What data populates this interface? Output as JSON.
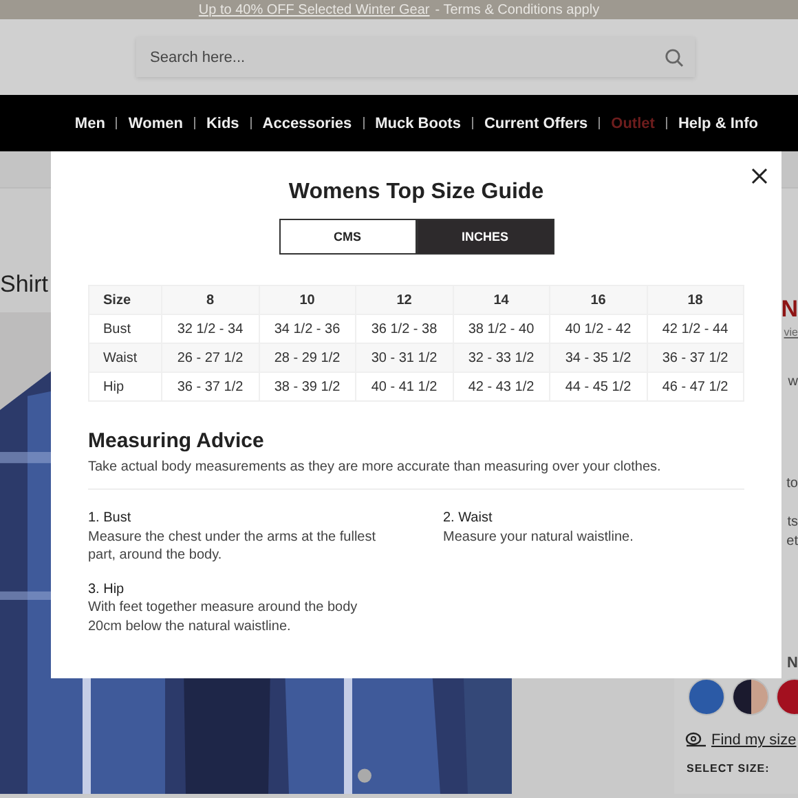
{
  "promo_bar": {
    "link": "Up to 40% OFF Selected Winter Gear",
    "text": "- Terms & Conditions apply"
  },
  "search": {
    "placeholder": "Search here..."
  },
  "nav": [
    {
      "label": "Men",
      "kind": "normal"
    },
    {
      "label": "Women",
      "kind": "normal"
    },
    {
      "label": "Kids",
      "kind": "normal"
    },
    {
      "label": "Accessories",
      "kind": "normal"
    },
    {
      "label": "Muck Boots",
      "kind": "normal"
    },
    {
      "label": "Current Offers",
      "kind": "normal"
    },
    {
      "label": "Outlet",
      "kind": "sale"
    },
    {
      "label": "Help & Info",
      "kind": "normal"
    }
  ],
  "product": {
    "title": "Shirt",
    "side_fragments": [
      {
        "text": "N",
        "kind": "price"
      },
      {
        "text": "vie",
        "kind": "link"
      },
      {
        "text": "w",
        "kind": "text"
      },
      {
        "text": "to",
        "kind": "text"
      },
      {
        "text": "ts",
        "kind": "text"
      },
      {
        "text": "et",
        "kind": "text"
      }
    ],
    "colour_label": "N",
    "swatches": [
      {
        "kind": "solid",
        "color": "#2b5aa6"
      },
      {
        "kind": "split",
        "parts": [
          {
            "color": "#1b1a2e"
          },
          {
            "color": "#c9a08c"
          }
        ]
      },
      {
        "kind": "solid",
        "color": "#a3101f"
      }
    ],
    "find_size": "Find my size",
    "select_size": "SELECT SIZE:"
  },
  "modal": {
    "title": "Womens Top Size Guide",
    "units": [
      {
        "label": "CMS",
        "selected": false
      },
      {
        "label": "INCHES",
        "selected": true
      }
    ],
    "table": {
      "columns": [
        "Size",
        "8",
        "10",
        "12",
        "14",
        "16",
        "18"
      ],
      "rows": [
        [
          "Bust",
          "32 1/2 - 34",
          "34 1/2 - 36",
          "36 1/2 - 38",
          "38 1/2 - 40",
          "40 1/2 - 42",
          "42 1/2 - 44"
        ],
        [
          "Waist",
          "26 - 27 1/2",
          "28 - 29 1/2",
          "30 - 31 1/2",
          "32 - 33 1/2",
          "34 - 35 1/2",
          "36 - 37 1/2"
        ],
        [
          "Hip",
          "36 - 37 1/2",
          "38 - 39 1/2",
          "40 - 41 1/2",
          "42 - 43 1/2",
          "44 - 45 1/2",
          "46 - 47 1/2"
        ]
      ]
    },
    "advice_heading": "Measuring Advice",
    "advice_intro": "Take actual body measurements as they are more accurate than measuring over your clothes.",
    "advice_items": [
      {
        "title": "1. Bust",
        "text": "Measure the chest under the arms at the fullest part, around the body."
      },
      {
        "title": "2. Waist",
        "text": "Measure your natural waistline."
      },
      {
        "title": "3. Hip",
        "text": "With feet together measure around the body 20cm below the natural waistline."
      }
    ]
  }
}
